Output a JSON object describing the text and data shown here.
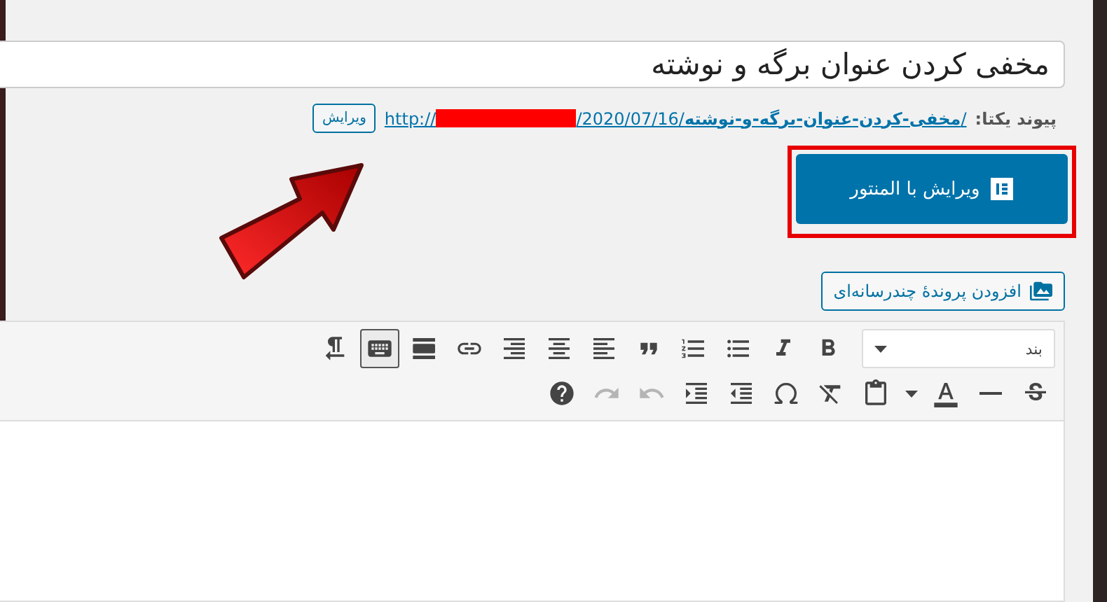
{
  "title_field": {
    "value": "مخفی کردن عنوان برگه و نوشته"
  },
  "permalink": {
    "label": "پیوند یکتا:",
    "link_prefix": "http://",
    "link_rest": "/2020/07/16/**مخفی-کردن-عنوان-برگه-و-نوشته**/",
    "redacted": true,
    "edit_button": "ویرایش"
  },
  "elementor_button": {
    "label": "ویرایش با المنتور",
    "highlighted": true
  },
  "add_media_button": {
    "label": "افزودن پروندهٔ چندرسانه‌ای"
  },
  "format_select": {
    "value": "بند"
  },
  "toolbar_rows": [
    [
      {
        "kind": "bold",
        "pressed": false,
        "disabled": false
      },
      {
        "kind": "italic",
        "pressed": false,
        "disabled": false
      },
      {
        "kind": "bullet-list",
        "pressed": false,
        "disabled": false
      },
      {
        "kind": "numbered-list",
        "pressed": false,
        "disabled": false
      },
      {
        "kind": "quote",
        "pressed": false,
        "disabled": false
      },
      {
        "kind": "align-left",
        "pressed": false,
        "disabled": false
      },
      {
        "kind": "align-center",
        "pressed": false,
        "disabled": false
      },
      {
        "kind": "align-right",
        "pressed": false,
        "disabled": false
      },
      {
        "kind": "link",
        "pressed": false,
        "disabled": false
      },
      {
        "kind": "read-more",
        "pressed": false,
        "disabled": false
      },
      {
        "kind": "toolbar-toggle",
        "pressed": true,
        "disabled": false
      },
      {
        "kind": "rtl",
        "pressed": false,
        "disabled": false
      }
    ],
    [
      {
        "kind": "strikethrough",
        "pressed": false,
        "disabled": false
      },
      {
        "kind": "horizontal-line",
        "pressed": false,
        "disabled": false
      },
      {
        "kind": "text-color",
        "pressed": false,
        "disabled": false
      },
      {
        "kind": "dropdown",
        "pressed": false,
        "disabled": false
      },
      {
        "kind": "paste-text",
        "pressed": false,
        "disabled": false
      },
      {
        "kind": "clear-format",
        "pressed": false,
        "disabled": false
      },
      {
        "kind": "omega",
        "pressed": false,
        "disabled": false
      },
      {
        "kind": "outdent",
        "pressed": false,
        "disabled": false
      },
      {
        "kind": "indent",
        "pressed": false,
        "disabled": false
      },
      {
        "kind": "undo",
        "pressed": false,
        "disabled": true
      },
      {
        "kind": "redo",
        "pressed": false,
        "disabled": true
      },
      {
        "kind": "help",
        "pressed": false,
        "disabled": false
      }
    ]
  ]
}
